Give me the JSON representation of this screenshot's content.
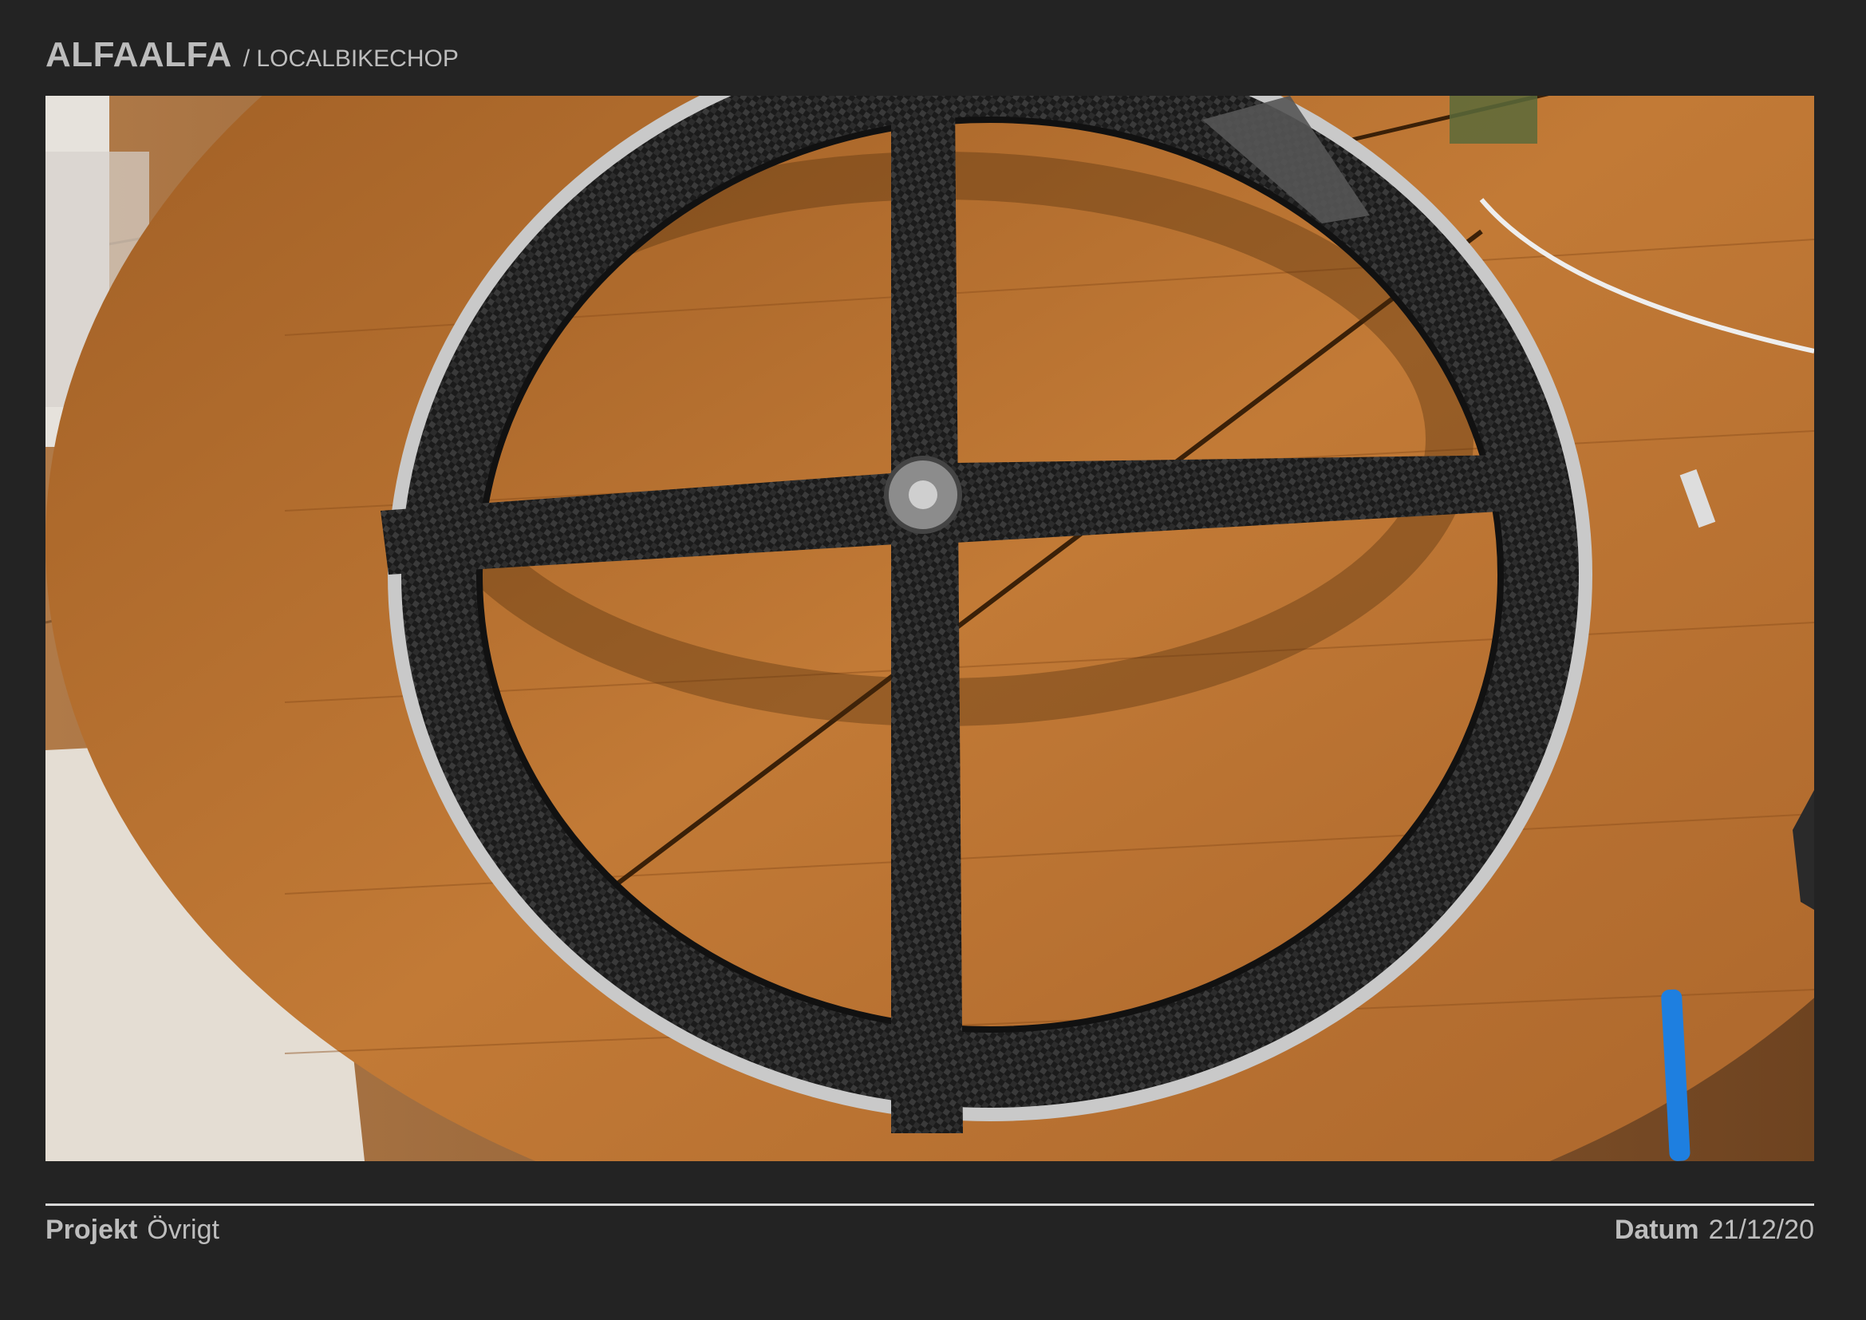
{
  "header": {
    "brand": "ALFAALFA",
    "subtitle": "/ LOCALBIKECHOP"
  },
  "photo": {
    "subject": "carbon-four-spoke-wheel",
    "colors": {
      "table_wood": "#b06a2a",
      "carbon": "#1c1c1c",
      "rim_metal": "#bfbfbf",
      "floor_wood": "#8a5a30",
      "pen_blue": "#1e7fe0"
    }
  },
  "footer": {
    "project_label": "Projekt",
    "project_value": "Övrigt",
    "date_label": "Datum",
    "date_value": "21/12/20"
  }
}
